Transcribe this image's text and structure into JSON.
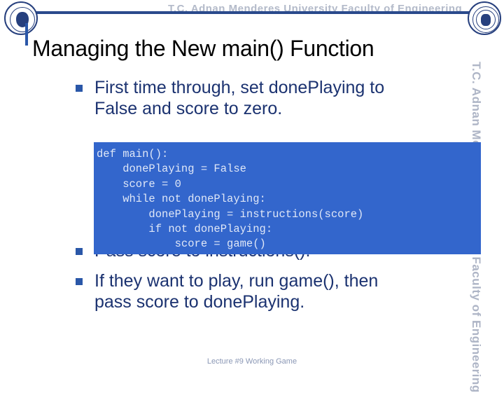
{
  "header": {
    "watermark": "T.C.    Adnan Menderes University    Faculty of Engineering",
    "left_seal_name": "adnan-menderes-university-seal",
    "right_seal_name": "faculty-of-engineering-seal"
  },
  "title": "Managing the New main() Function",
  "side_watermark": "T.C.   Adnan Menderes University   Faculty of Engineering",
  "bullets": [
    {
      "text": "First time through, set donePlaying to False and score to zero."
    },
    {
      "text": "Pass score to instructions()."
    },
    {
      "text": "If they want to play, run game(), then pass score to donePlaying."
    }
  ],
  "code": "def main():\n    donePlaying = False\n    score = 0\n    while not donePlaying:\n        donePlaying = instructions(score)\n        if not donePlaying:\n            score = game()",
  "footer": "Lecture #9 Working Game",
  "colors": {
    "title_text": "#000000",
    "bullet_text": "#1b3270",
    "accent_blue": "#2a57a8",
    "rule_blue": "#2a4a8c",
    "code_bg": "#3366cc",
    "code_text": "#dfe7f7",
    "watermark_gray": "#9aa3b8",
    "footer_gray": "#8a97b5"
  }
}
